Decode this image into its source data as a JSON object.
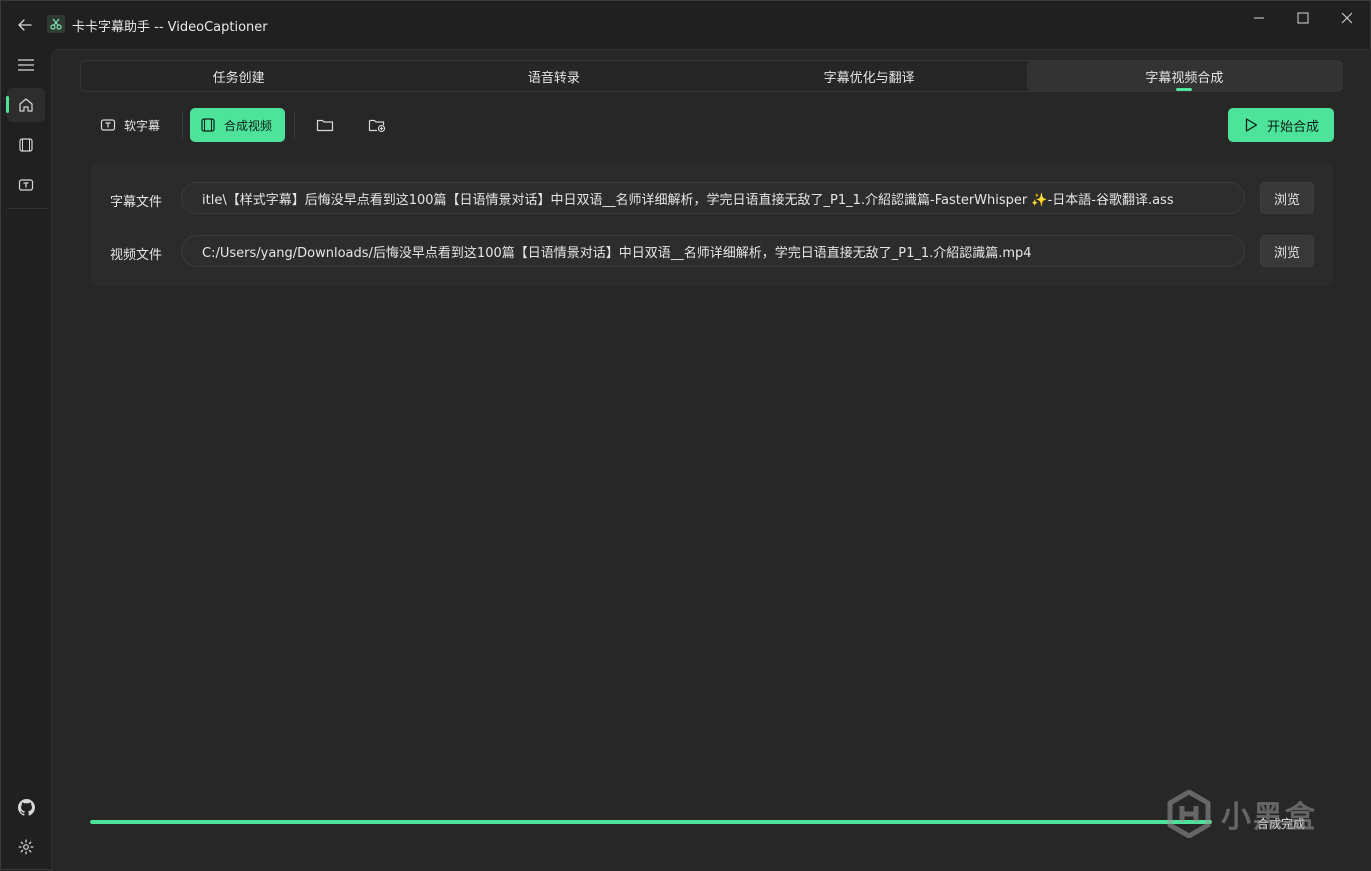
{
  "app": {
    "title": "卡卡字幕助手 -- VideoCaptioner"
  },
  "tabs": [
    {
      "label": "任务创建",
      "active": false
    },
    {
      "label": "语音转录",
      "active": false
    },
    {
      "label": "字幕优化与翻译",
      "active": false
    },
    {
      "label": "字幕视频合成",
      "active": true
    }
  ],
  "toolbar": {
    "soft_subtitle_label": "软字幕",
    "merge_video_label": "合成视频",
    "start_label": "开始合成"
  },
  "files": {
    "subtitle_label": "字幕文件",
    "subtitle_value": "itle\\【样式字幕】后悔没早点看到这100篇【日语情景对话】中日双语__名师详细解析，学完日语直接无敌了_P1_1.介紹認識篇-FasterWhisper ✨-日本語-谷歌翻译.ass",
    "video_label": "视频文件",
    "video_value": "C:/Users/yang/Downloads/后悔没早点看到这100篇【日语情景对话】中日双语__名师详细解析，学完日语直接无敌了_P1_1.介紹認識篇.mp4",
    "browse_label": "浏览"
  },
  "progress": {
    "value": 100,
    "status": "合成完成"
  },
  "watermark": {
    "text": "小黑盒"
  },
  "colors": {
    "accent": "#4ee39a",
    "background": "#202020",
    "panel": "#272727"
  }
}
